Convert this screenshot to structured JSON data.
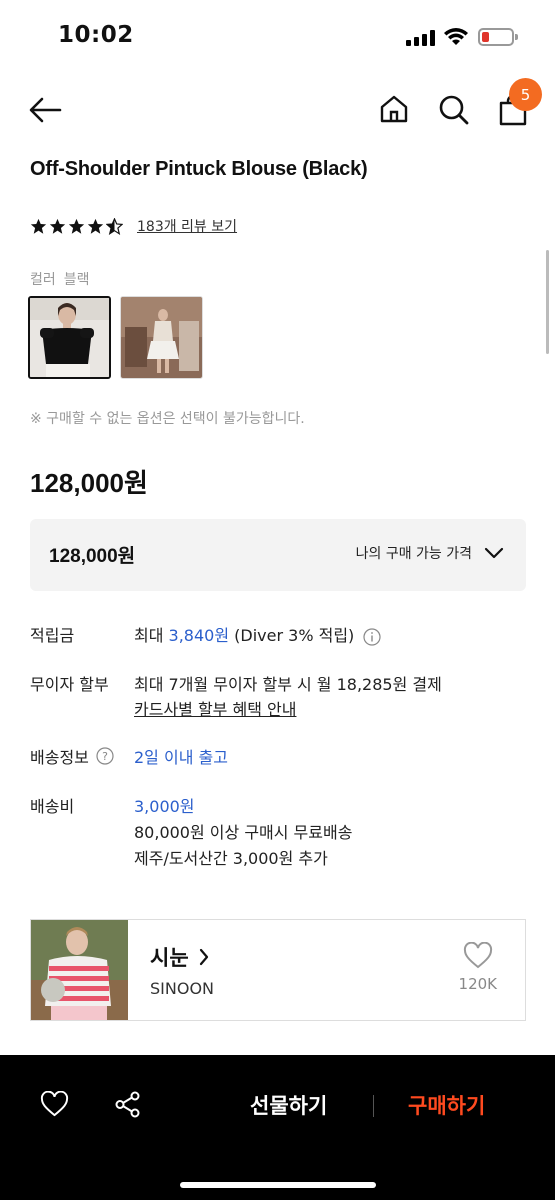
{
  "status": {
    "time": "10:02"
  },
  "nav": {
    "cart_count": "5"
  },
  "product": {
    "title": "Off-Shoulder Pintuck Blouse (Black)",
    "rating": 4.5,
    "review_link": "183개 리뷰 보기",
    "color_label": "컬러",
    "color_value": "블랙",
    "option_notice": "※ 구매할 수 없는 옵션은 선택이 불가능합니다.",
    "price": "128,000원"
  },
  "price_box": {
    "value": "128,000원",
    "toggle_label": "나의 구매 가능 가격"
  },
  "info": {
    "points_label": "적립금",
    "points_prefix": "최대 ",
    "points_amount": "3,840원",
    "points_suffix": " (Diver 3% 적립)",
    "installment_label": "무이자 할부",
    "installment_text": "최대 7개월 무이자 할부 시 월 18,285원 결제",
    "installment_link": "카드사별 할부 혜택 안내",
    "shipping_info_label": "배송정보",
    "shipping_info_value": "2일 이내 출고",
    "shipping_fee_label": "배송비",
    "shipping_fee_value": "3,000원",
    "shipping_fee_line2": "80,000원 이상 구매시 무료배송",
    "shipping_fee_line3": "제주/도서산간 3,000원 추가"
  },
  "brand": {
    "name": "시눈",
    "sub": "SINOON",
    "likes": "120K"
  },
  "bottom": {
    "gift_label": "선물하기",
    "buy_label": "구매하기"
  },
  "colors": {
    "accent_orange": "#f36b21",
    "buy_red": "#ff4a1f",
    "link_blue": "#2b5fcc"
  }
}
